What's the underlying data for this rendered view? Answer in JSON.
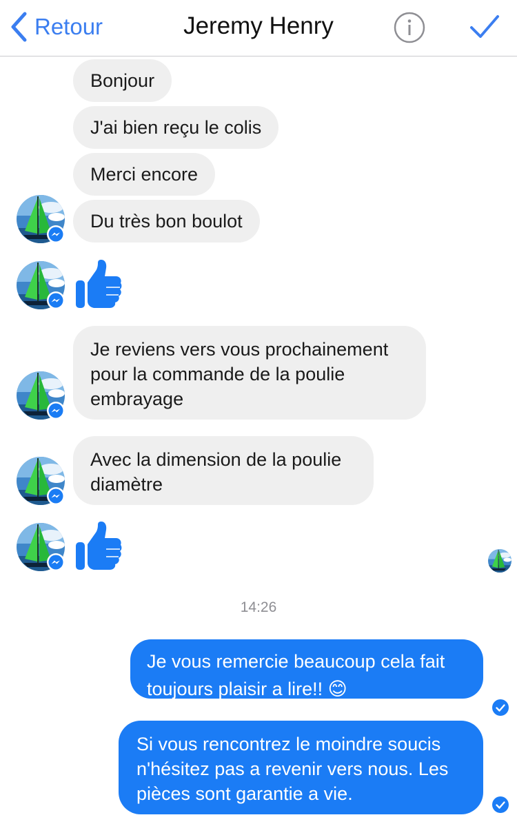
{
  "header": {
    "back_label": "Retour",
    "contact_name": "Jeremy Henry",
    "info_icon": "info-circle-icon",
    "done_icon": "checkmark-icon"
  },
  "messages": {
    "m1": "Bonjour",
    "m2": "J'ai bien reçu le colis",
    "m3": "Merci encore",
    "m4": "Du très bon boulot",
    "m5_line1": "Je reviens vers vous prochainement",
    "m5_line2": "pour la commande de la poulie",
    "m5_line3": "embrayage",
    "m6_line1": "Avec la dimension de la poulie",
    "m6_line2": "diamètre",
    "timestamp": "14:26",
    "out1_line1": "Je vous remercie beaucoup cela fait",
    "out1_line2": "toujours plaisir a lire!! 😊",
    "out2_line1": "Si vous rencontrez le moindre soucis",
    "out2_line2": "n'hésitez pas a revenir vers nous. Les",
    "out2_line3": "pièces sont garantie a vie."
  },
  "colors": {
    "accent_blue": "#3b7ef0",
    "outgoing_bubble": "#1b7cf5",
    "incoming_bubble": "#efefef",
    "messenger_badge": "#1a7cf4"
  }
}
